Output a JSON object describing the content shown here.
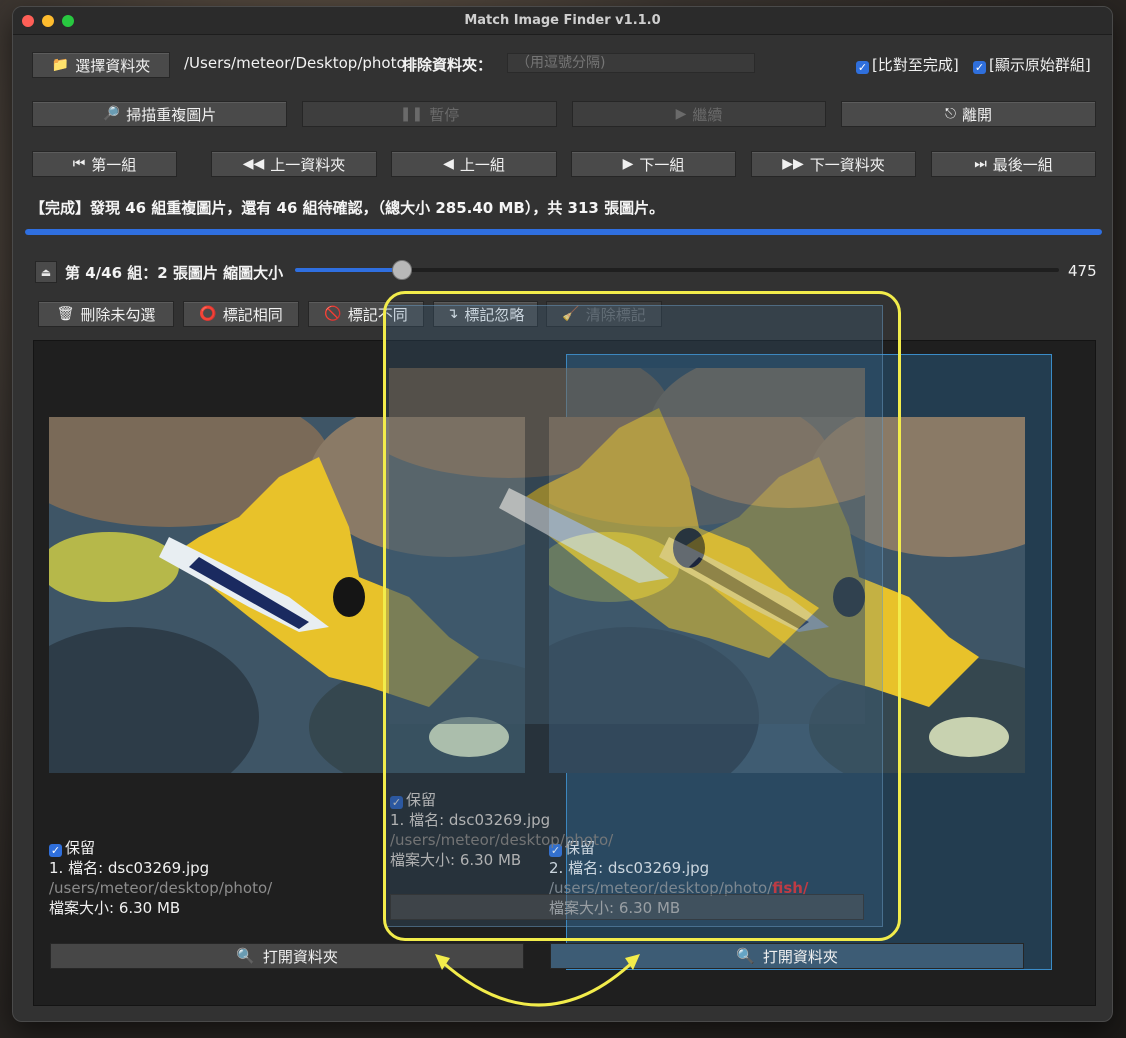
{
  "window": {
    "title": "Match Image Finder v1.1.0"
  },
  "toolbar1": {
    "select_folder_label": "選擇資料夾",
    "folder_path": "/Users/meteor/Desktop/photo",
    "exclude_label": "排除資料夾：",
    "exclude_placeholder": "（用逗號分隔)",
    "compare_to_finish": "[比對至完成]",
    "show_original_group": "[顯示原始群組]"
  },
  "toolbar2": {
    "scan_label": "掃描重複圖片",
    "pause_label": "暫停",
    "continue_label": "繼續",
    "exit_label": "離開"
  },
  "nav": {
    "first_group": "第一組",
    "prev_folder": "上一資料夾",
    "prev": "上一組",
    "next": "下一組",
    "next_folder": "下一資料夾",
    "last_group": "最後一組"
  },
  "status_text": "【完成】發現 46 組重複圖片，還有 46 組待確認，（總大小 285.40 MB），共 313 張圖片。",
  "progress": 1.0,
  "group": {
    "label": "第 4/46 組：2 張圖片  縮圖大小",
    "thumb_size": "475",
    "thumb_fraction": 0.14
  },
  "actions": {
    "delete_unchecked": "刪除未勾選",
    "mark_same": "標記相同",
    "mark_different": "標記不同",
    "mark_ignore": "標記忽略",
    "clear_marks": "清除標記"
  },
  "images": [
    {
      "keep_label": "保留",
      "filename": "1. 檔名: dsc03269.jpg",
      "path": "/users/meteor/desktop/photo/",
      "path_highlight": "",
      "size": "檔案大小: 6.30 MB",
      "open_folder": "打開資料夾"
    },
    {
      "keep_label": "保留",
      "filename": "2. 檔名: dsc03269.jpg",
      "path": "/users/meteor/desktop/photo/",
      "path_highlight": "fish/",
      "size": "檔案大小: 6.30 MB",
      "open_folder": "打開資料夾"
    }
  ],
  "ghost": {
    "keep_label": "保留",
    "filename": "1. 檔名: dsc03269.jpg",
    "path": "/users/meteor/desktop/photo/",
    "size": "檔案大小: 6.30 MB"
  },
  "colors": {
    "accent": "#2f6fe0",
    "highlight": "#f2ec4b",
    "selection": "#3a8cc8",
    "path_red": "#e02b2b"
  }
}
